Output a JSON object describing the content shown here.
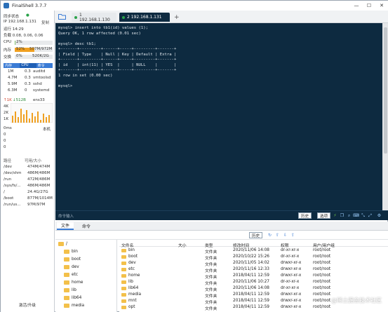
{
  "app": {
    "title": "FinalShell 3.7.7",
    "min": "—",
    "max": "☐",
    "close": "✕"
  },
  "sidebar": {
    "sync_label": "同步状态",
    "sync_status": "●",
    "ip_label": "IP 192.168.1.131",
    "copy": "复制",
    "uptime": "运行 14:29",
    "load": "负载 0.08, 0.06, 0.06",
    "cpu_label": "CPU",
    "cpu_value": "2%",
    "cpu_pct": 2,
    "mem_label": "内存",
    "mem_pct_text": "52%",
    "mem_value": "507M/972M",
    "mem_pct": 52,
    "swap_label": "交换",
    "swap_pct_text": "0%",
    "swap_value": "520K/2G",
    "swap_pct": 0,
    "proc_headers": [
      "内存",
      "CPU",
      "命令"
    ],
    "procs": [
      {
        "mem": "1M",
        "cpu": "0.3",
        "cmd": "auditd"
      },
      {
        "mem": "4.7M",
        "cpu": "0.3",
        "cmd": "vmtoolsd"
      },
      {
        "mem": "5.9M",
        "cpu": "0.3",
        "cmd": "sshd"
      },
      {
        "mem": "6.3M",
        "cpu": "0",
        "cmd": "systemd"
      }
    ],
    "net_up": "↑1K",
    "net_down": "↓512B",
    "net_if": "ens33",
    "net_scale": [
      "4K",
      "2K",
      "1K"
    ],
    "ping_label": "0ms",
    "ping_host": "本机",
    "ping_scale": [
      "0",
      "0",
      "0"
    ],
    "disk_headers": [
      "路径",
      "可用/大小"
    ],
    "disks": [
      {
        "path": "/dev",
        "size": "474M/474M"
      },
      {
        "path": "/dev/shm",
        "size": "486M/486M"
      },
      {
        "path": "/run",
        "size": "472M/486M"
      },
      {
        "path": "/sys/fs/...",
        "size": "486M/486M"
      },
      {
        "path": "/",
        "size": "24.4G/27G"
      },
      {
        "path": "/boot",
        "size": "877M/1014M"
      },
      {
        "path": "/run/us...",
        "size": "97M/97M"
      }
    ],
    "upgrade": "激活/升级"
  },
  "tabs": [
    {
      "label": "1 192.168.1.130"
    },
    {
      "label": "2 192.168.1.131"
    }
  ],
  "add_tab": "+",
  "terminal": {
    "lines": [
      "mysql> insert into tb1(id) values (1);",
      "Query OK, 1 row affected (0.01 sec)",
      "",
      "mysql> desc tb1;",
      "+-------+---------+------+-----+---------+-------+",
      "| Field | Type    | Null | Key | Default | Extra |",
      "+-------+---------+------+-----+---------+-------+",
      "| id    | int(11) | YES  |     | NULL    |       |",
      "+-------+---------+------+-----+---------+-------+",
      "1 row in set (0.00 sec)",
      "",
      "mysql> "
    ]
  },
  "cmdbar": {
    "placeholder": "命令输入",
    "history": "历史",
    "options": "选项"
  },
  "files": {
    "tab_file": "文件",
    "tab_cmd": "命令",
    "path": "/",
    "history": "历史",
    "tree": [
      "/",
      "bin",
      "boot",
      "dev",
      "etc",
      "home",
      "lib",
      "lib64",
      "media"
    ],
    "headers": [
      "文件名",
      "大小",
      "类型",
      "修改时间",
      "权限",
      "用户/用户组"
    ],
    "rows": [
      {
        "name": "bin",
        "size": "",
        "type": "文件夹",
        "time": "2020/11/06 14:08",
        "perm": "dr-xr-xr-x",
        "owner": "root/root"
      },
      {
        "name": "boot",
        "size": "",
        "type": "文件夹",
        "time": "2020/10/22 15:26",
        "perm": "dr-xr-xr-x",
        "owner": "root/root"
      },
      {
        "name": "dev",
        "size": "",
        "type": "文件夹",
        "time": "2020/11/05 14:02",
        "perm": "drwxr-xr-x",
        "owner": "root/root"
      },
      {
        "name": "etc",
        "size": "",
        "type": "文件夹",
        "time": "2020/11/16 12:33",
        "perm": "drwxr-xr-x",
        "owner": "root/root"
      },
      {
        "name": "home",
        "size": "",
        "type": "文件夹",
        "time": "2018/04/11 12:59",
        "perm": "drwxr-xr-x",
        "owner": "root/root"
      },
      {
        "name": "lib",
        "size": "",
        "type": "文件夹",
        "time": "2020/11/06 10:27",
        "perm": "dr-xr-xr-x",
        "owner": "root/root"
      },
      {
        "name": "lib64",
        "size": "",
        "type": "文件夹",
        "time": "2020/11/06 14:08",
        "perm": "dr-xr-xr-x",
        "owner": "root/root"
      },
      {
        "name": "media",
        "size": "",
        "type": "文件夹",
        "time": "2018/04/11 12:59",
        "perm": "drwxr-xr-x",
        "owner": "root/root"
      },
      {
        "name": "mnt",
        "size": "",
        "type": "文件夹",
        "time": "2018/04/11 12:59",
        "perm": "drwxr-xr-x",
        "owner": "root/root"
      },
      {
        "name": "opt",
        "size": "",
        "type": "文件夹",
        "time": "2018/04/11 12:59",
        "perm": "drwxr-xr-x",
        "owner": "root/root"
      }
    ]
  },
  "watermark": "@稀土掘金技术社区",
  "colors": {
    "accent": "#3a7bd5",
    "terminal_bg": "#0d2a40",
    "mem": "#f0a020",
    "active_tab": "#0d2a40"
  }
}
